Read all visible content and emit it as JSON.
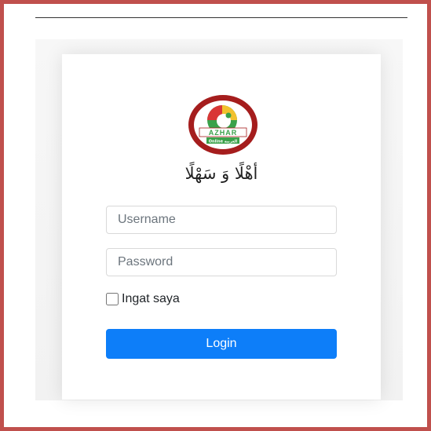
{
  "logo": {
    "brand_text": "AZHAR",
    "sub_text": "Online العربية",
    "colors": {
      "ring": "#a51d1d",
      "inner": "#ffffff",
      "green": "#3aa14a",
      "yellow": "#f2c12e",
      "red": "#d93636"
    }
  },
  "login": {
    "welcome_text": "أهْلًا وَ سَهْلًا",
    "username_placeholder": "Username",
    "password_placeholder": "Password",
    "remember_label": "Ingat saya",
    "login_label": "Login"
  },
  "colors": {
    "frame_border": "#c0504d",
    "button": "#0d7ef9"
  }
}
